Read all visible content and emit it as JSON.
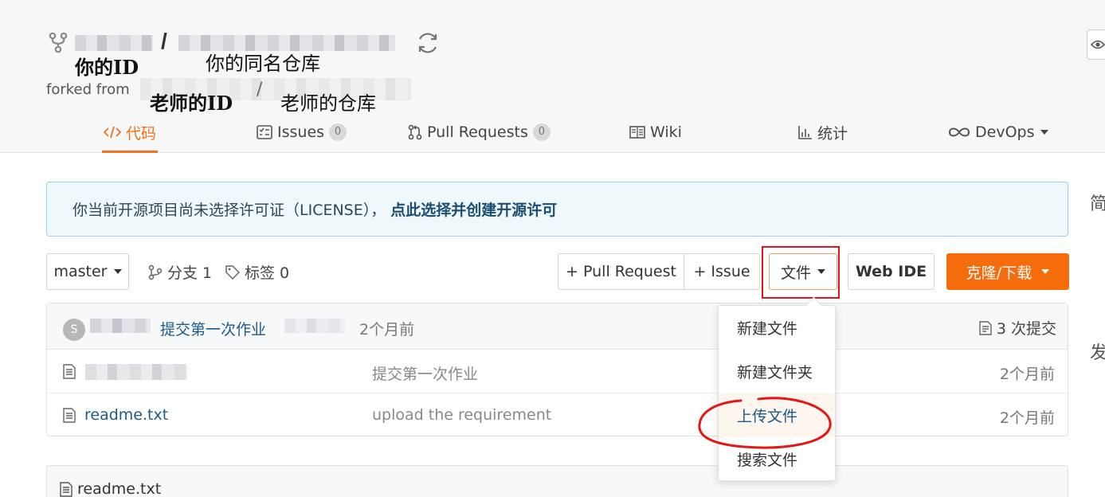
{
  "header": {
    "repo_separator": "/",
    "annotation_your_id": "你的ID",
    "annotation_your_repo": "你的同名仓库",
    "forked_from": "forked from",
    "annotation_teacher_id": "老师的ID",
    "teacher_separator": "/",
    "annotation_teacher_repo": "老师的仓库",
    "annotation_color": "#111111"
  },
  "tabs": [
    {
      "label": "代码",
      "icon": "code-icon",
      "active": true
    },
    {
      "label": "Issues",
      "icon": "issues-icon",
      "count": "0"
    },
    {
      "label": "Pull Requests",
      "icon": "pull-request-icon",
      "count": "0"
    },
    {
      "label": "Wiki",
      "icon": "wiki-icon"
    },
    {
      "label": "统计",
      "icon": "bar-chart-icon"
    },
    {
      "label": "DevOps",
      "icon": "infinity-icon"
    }
  ],
  "banner": {
    "text": "你当前开源项目尚未选择许可证（LICENSE），",
    "link": "点此选择并创建开源许可"
  },
  "toolbar": {
    "branch": "master",
    "branches": "分支 1",
    "tags": "标签 0",
    "pull_request": "+ Pull Request",
    "issue": "+ Issue",
    "file": "文件",
    "web_ide": "Web IDE",
    "clone": "克隆/下载"
  },
  "commit": {
    "avatar_letter": "S",
    "message": "提交第一次作业",
    "time": "2个月前",
    "count": "3 次提交"
  },
  "files": [
    {
      "name": "",
      "message": "提交第一次作业",
      "time": "2个月前"
    },
    {
      "name": "readme.txt",
      "message": "upload the requirement",
      "time": "2个月前"
    }
  ],
  "file_menu": {
    "items": [
      "新建文件",
      "新建文件夹",
      "上传文件",
      "搜索文件"
    ]
  },
  "readme": {
    "title": "readme.txt"
  },
  "colors": {
    "accent": "#f0741f",
    "clone_button": "#f46c0b",
    "link": "#1b5a8a",
    "banner_bg": "#eff8fb",
    "highlight_red": "#e5141c"
  }
}
